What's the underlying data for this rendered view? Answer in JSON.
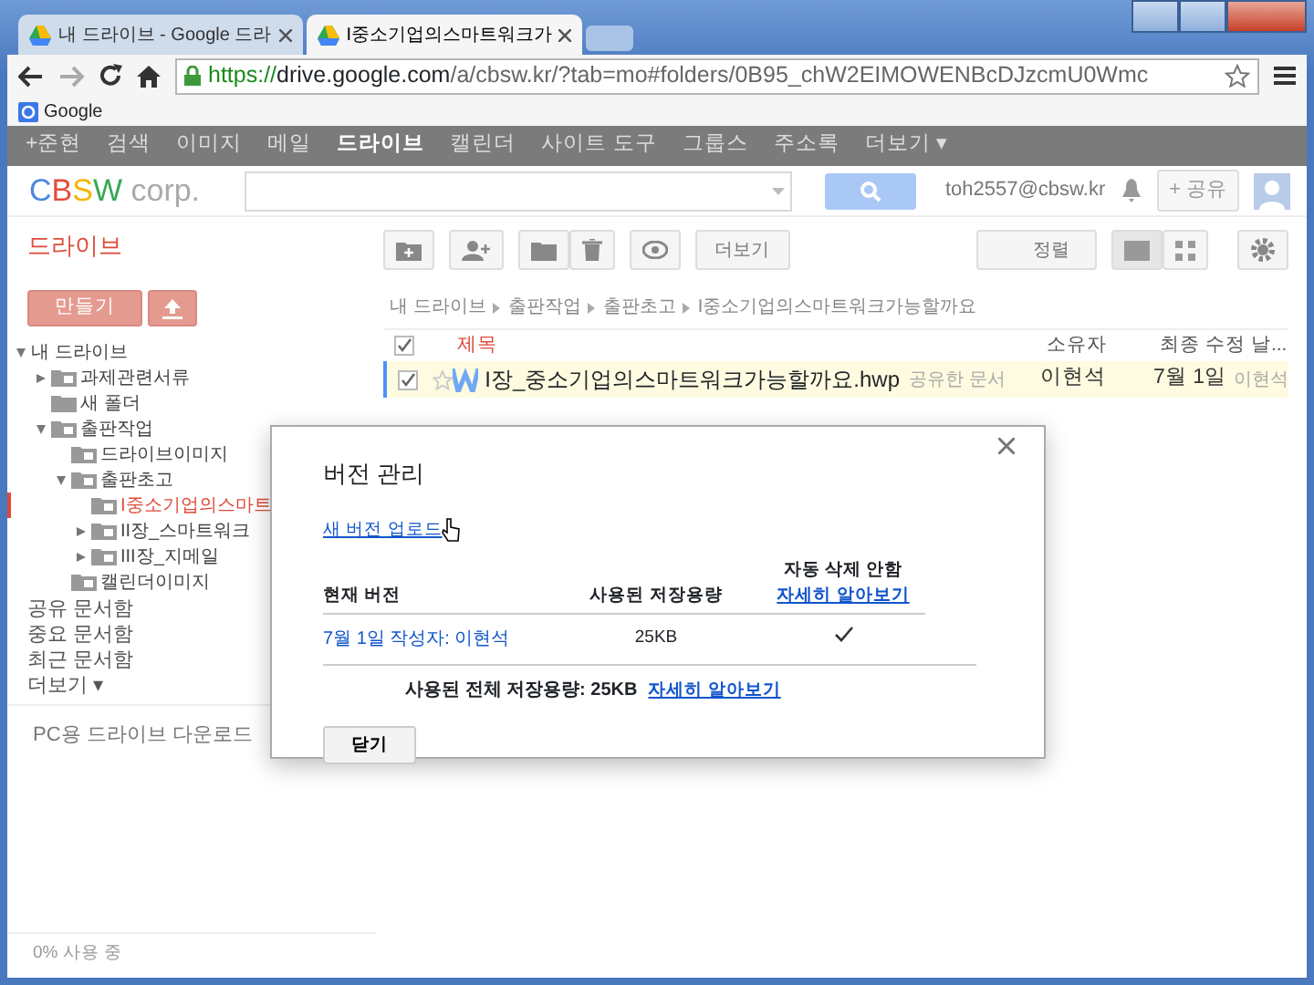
{
  "browser": {
    "tabs": [
      {
        "title": "내 드라이브 - Google 드라",
        "selected": false
      },
      {
        "title": "I중소기업의스마트워크가",
        "selected": true
      }
    ],
    "address": {
      "scheme": "https://",
      "host": "drive.google.com",
      "path": "/a/cbsw.kr/?tab=mo#folders/0B95_chW2EIMOWENBcDJzcmU0Wmc"
    },
    "bookmarks": [
      "Google"
    ]
  },
  "google_bar": [
    {
      "label": "+준현",
      "selected": false
    },
    {
      "label": "검색",
      "selected": false
    },
    {
      "label": "이미지",
      "selected": false
    },
    {
      "label": "메일",
      "selected": false
    },
    {
      "label": "드라이브",
      "selected": true
    },
    {
      "label": "캘린더",
      "selected": false
    },
    {
      "label": "사이트 도구",
      "selected": false
    },
    {
      "label": "그룹스",
      "selected": false
    },
    {
      "label": "주소록",
      "selected": false
    },
    {
      "label": "더보기 ▾",
      "selected": false
    }
  ],
  "header": {
    "logo": [
      "C",
      "B",
      "S",
      "W",
      " corp."
    ],
    "account": "toh2557@cbsw.kr",
    "share": "+ 공유"
  },
  "drive_title": "드라이브",
  "create_button": "만들기",
  "toolbar": {
    "more": "더보기",
    "sort": "정렬"
  },
  "tree": [
    {
      "label": "내 드라이브",
      "expanded": true,
      "children": [
        {
          "label": "과제관련서류",
          "kind": "shared",
          "expanded": false
        },
        {
          "label": "새 폴더",
          "kind": "folder"
        },
        {
          "label": "출판작업",
          "kind": "shared",
          "expanded": true,
          "children": [
            {
              "label": "드라이브이미지",
              "kind": "shared"
            },
            {
              "label": "출판초고",
              "kind": "shared",
              "expanded": true,
              "children": [
                {
                  "label": "I중소기업의스마트",
                  "kind": "shared",
                  "selected": true
                },
                {
                  "label": "II장_스마트워크",
                  "kind": "shared",
                  "expanded": false
                },
                {
                  "label": "III장_지메일",
                  "kind": "shared",
                  "expanded": false
                }
              ]
            },
            {
              "label": "캘린더이미지",
              "kind": "shared"
            }
          ]
        }
      ]
    }
  ],
  "sidebar_links": [
    "공유 문서함",
    "중요 문서함",
    "최근 문서함",
    "더보기 ▾"
  ],
  "download_link": "PC용 드라이브 다운로드",
  "usage": "0% 사용 중",
  "breadcrumb": [
    "내 드라이브",
    "출판작업",
    "출판초고",
    "I중소기업의스마트워크가능할까요"
  ],
  "table": {
    "columns": [
      "제목",
      "소유자",
      "최종 수정 날..."
    ],
    "all_checked": true,
    "rows": [
      {
        "title": "I장_중소기업의스마트워크가능할까요.hwp",
        "checked": true,
        "tag": "공유한 문서",
        "owner": "이현석",
        "modified": "7월 1일",
        "modifier": "이현석",
        "selected": true,
        "starred": false
      }
    ]
  },
  "dialog": {
    "title": "버전 관리",
    "upload_link": "새 버전 업로드",
    "columns": [
      "현재 버전",
      "사용된 저장용량",
      "자동 삭제 안함"
    ],
    "column_link": "자세히 알아보기",
    "rows": [
      {
        "version": "7월 1일 작성자: 이현석",
        "size": "25KB",
        "keep_forever": true
      }
    ],
    "total": "사용된 전체 저장용량: 25KB",
    "total_link": "자세히 알아보기",
    "close_button": "닫기"
  }
}
